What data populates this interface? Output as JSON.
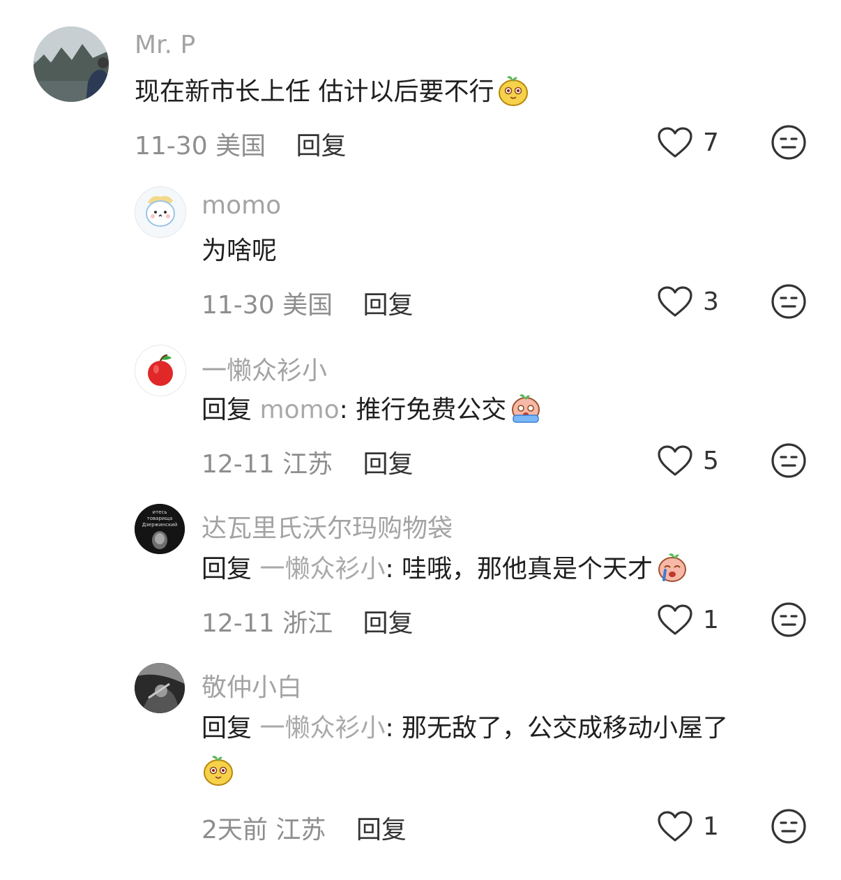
{
  "comments": [
    {
      "name": "Mr. P",
      "text": "现在新市长上任 估计以后要不行",
      "date": "11-30",
      "region": "美国",
      "reply_label": "回复",
      "likes": "7",
      "emoji": "yellow-mascot-smile"
    },
    {
      "name": "momo",
      "text": "为啥呢",
      "date": "11-30",
      "region": "美国",
      "reply_label": "回复",
      "likes": "3"
    },
    {
      "name": "一懒众衫小",
      "reply_prefix": "回复 ",
      "reply_target": "momo",
      "text": ": 推行免费公交",
      "date": "12-11",
      "region": "江苏",
      "reply_label": "回复",
      "likes": "5",
      "emoji": "pink-mascot-crying"
    },
    {
      "name": "达瓦里氏沃尔玛购物袋",
      "reply_prefix": "回复 ",
      "reply_target": "一懒众衫小",
      "text": ": 哇哦，那他真是个天才",
      "date": "12-11",
      "region": "浙江",
      "reply_label": "回复",
      "likes": "1",
      "emoji": "pink-mascot-crying",
      "avatar_text": [
        "итесь",
        "товарища",
        "Дзержинский"
      ]
    },
    {
      "name": "敬仲小白",
      "reply_prefix": "回复 ",
      "reply_target": "一懒众衫小",
      "text": ": 那无敌了，公交成移动小屋了",
      "date": "2天前",
      "region": "江苏",
      "reply_label": "回复",
      "likes": "1",
      "emoji": "yellow-mascot-smile"
    }
  ],
  "colors": {
    "name": "#a3a3a3",
    "text": "#1f1f1f",
    "meta": "#8e8e8e",
    "icon_stroke": "#333333"
  }
}
